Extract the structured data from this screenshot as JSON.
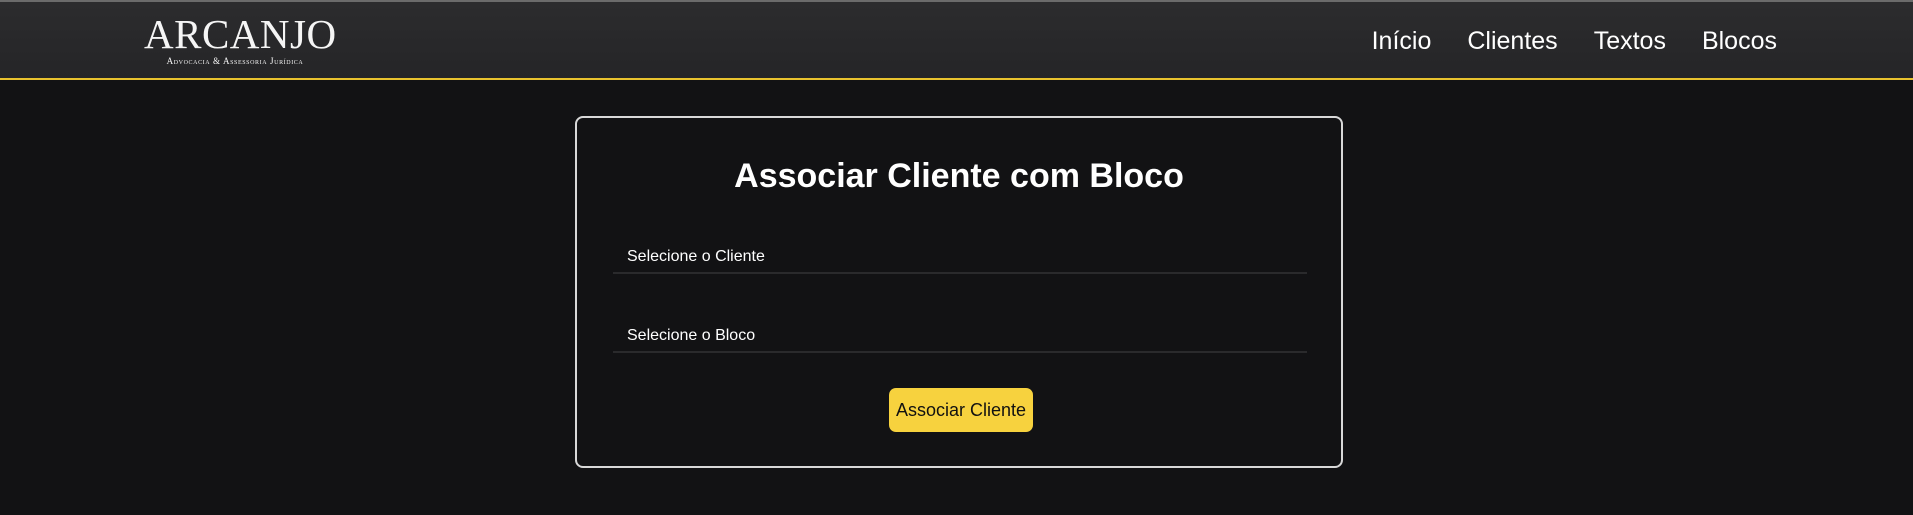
{
  "header": {
    "logo": {
      "title": "ARCANJO",
      "subtitle": "Advocacia & Assessoria Jurídica"
    },
    "nav": [
      {
        "label": "Início"
      },
      {
        "label": "Clientes"
      },
      {
        "label": "Textos"
      },
      {
        "label": "Blocos"
      }
    ]
  },
  "form": {
    "title": "Associar Cliente com Bloco",
    "cliente_select": {
      "selected": "Selecione o Cliente"
    },
    "bloco_select": {
      "selected": "Selecione o Bloco"
    },
    "submit_label": "Associar Cliente"
  },
  "colors": {
    "background": "#121214",
    "navbar": "#2a2a2c",
    "accent": "#f7d23e",
    "card_border": "#d8d8d8",
    "text": "#ffffff"
  }
}
